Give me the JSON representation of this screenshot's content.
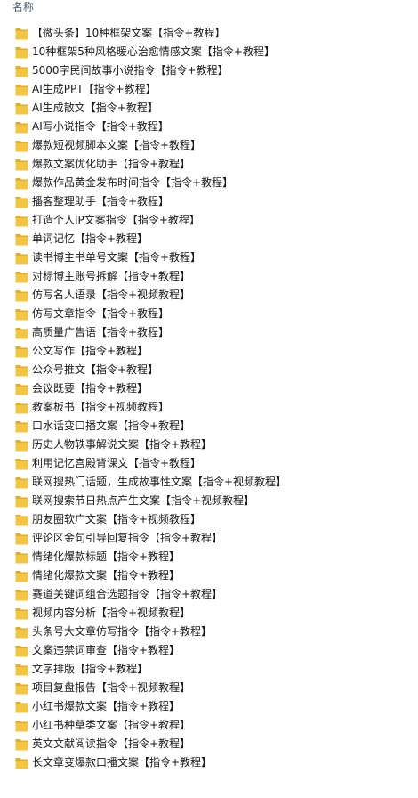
{
  "header": {
    "name_label": "名称"
  },
  "colors": {
    "folder": "#f5c542",
    "folder_dark": "#e6ad2a",
    "header_text": "#4c607a"
  },
  "items": [
    {
      "label": "【微头条】10种框架文案【指令+教程】"
    },
    {
      "label": "10种框架5种风格暖心治愈情感文案【指令+教程】"
    },
    {
      "label": "5000字民间故事小说指令【指令+教程】"
    },
    {
      "label": "AI生成PPT【指令+教程】"
    },
    {
      "label": "AI生成散文【指令+教程】"
    },
    {
      "label": "AI写小说指令【指令+教程】"
    },
    {
      "label": "爆款短视频脚本文案【指令+教程】"
    },
    {
      "label": "爆款文案优化助手【指令+教程】"
    },
    {
      "label": "爆款作品黄金发布时间指令【指令+教程】"
    },
    {
      "label": "播客整理助手【指令+教程】"
    },
    {
      "label": "打造个人IP文案指令【指令+教程】"
    },
    {
      "label": "单词记忆【指令+教程】"
    },
    {
      "label": "读书博主书单号文案【指令+教程】"
    },
    {
      "label": "对标博主账号拆解【指令+教程】"
    },
    {
      "label": "仿写名人语录【指令+视频教程】"
    },
    {
      "label": "仿写文章指令【指令+教程】"
    },
    {
      "label": "高质量广告语【指令+教程】"
    },
    {
      "label": "公文写作【指令+教程】"
    },
    {
      "label": "公众号推文【指令+教程】"
    },
    {
      "label": "会议既要【指令+教程】"
    },
    {
      "label": "教案板书【指令+视频教程】"
    },
    {
      "label": "口水话变口播文案【指令+教程】"
    },
    {
      "label": "历史人物轶事解说文案【指令+教程】"
    },
    {
      "label": "利用记忆宫殿背课文【指令+教程】"
    },
    {
      "label": "联网搜热门话题，生成故事性文案【指令+视频教程】"
    },
    {
      "label": "联网搜索节日热点产生文案【指令+视频教程】"
    },
    {
      "label": "朋友圈软广文案【指令+视频教程】"
    },
    {
      "label": "评论区金句引导回复指令【指令+教程】"
    },
    {
      "label": "情绪化爆款标题【指令+教程】"
    },
    {
      "label": "情绪化爆款文案【指令+教程】"
    },
    {
      "label": "赛道关键词组合选题指令【指令+教程】"
    },
    {
      "label": "视频内容分析【指令+视频教程】"
    },
    {
      "label": "头条号大文章仿写指令【指令+教程】"
    },
    {
      "label": "文案违禁词审查【指令+教程】"
    },
    {
      "label": "文字排版【指令+教程】"
    },
    {
      "label": "项目复盘报告【指令+视频教程】"
    },
    {
      "label": "小红书爆款文案【指令+教程】"
    },
    {
      "label": "小红书种草类文案【指令+教程】"
    },
    {
      "label": "英文文献阅读指令【指令+教程】"
    },
    {
      "label": "长文章变爆款口播文案【指令+教程】"
    }
  ]
}
